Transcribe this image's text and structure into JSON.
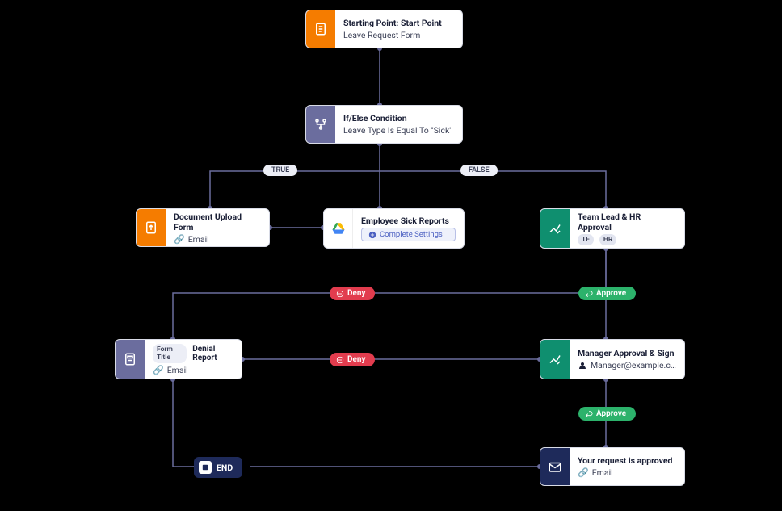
{
  "nodes": {
    "start": {
      "title": "Starting Point: Start Point",
      "sub": "Leave Request Form"
    },
    "condition": {
      "title": "If/Else Condition",
      "sub": "Leave Type Is Equal To \"Sick'"
    },
    "upload": {
      "title": "Document Upload Form",
      "sub": "Email"
    },
    "drive": {
      "title": "Employee Sick Reports",
      "button": "Complete Settings"
    },
    "approval1": {
      "title": "Team Lead & HR Approval",
      "tags": [
        "TF",
        "HR"
      ]
    },
    "denial": {
      "formTitleLabel": "Form Title",
      "formTitleValue": "Denial Report",
      "sub": "Email"
    },
    "approval2": {
      "title": "Manager Approval & Sign",
      "sub": "Manager@example.c…"
    },
    "approved": {
      "title": "Your request is approved",
      "sub": "Email"
    },
    "end": {
      "label": "END"
    }
  },
  "labels": {
    "true": "TRUE",
    "false": "FALSE",
    "approve": "Approve",
    "deny": "Deny"
  }
}
